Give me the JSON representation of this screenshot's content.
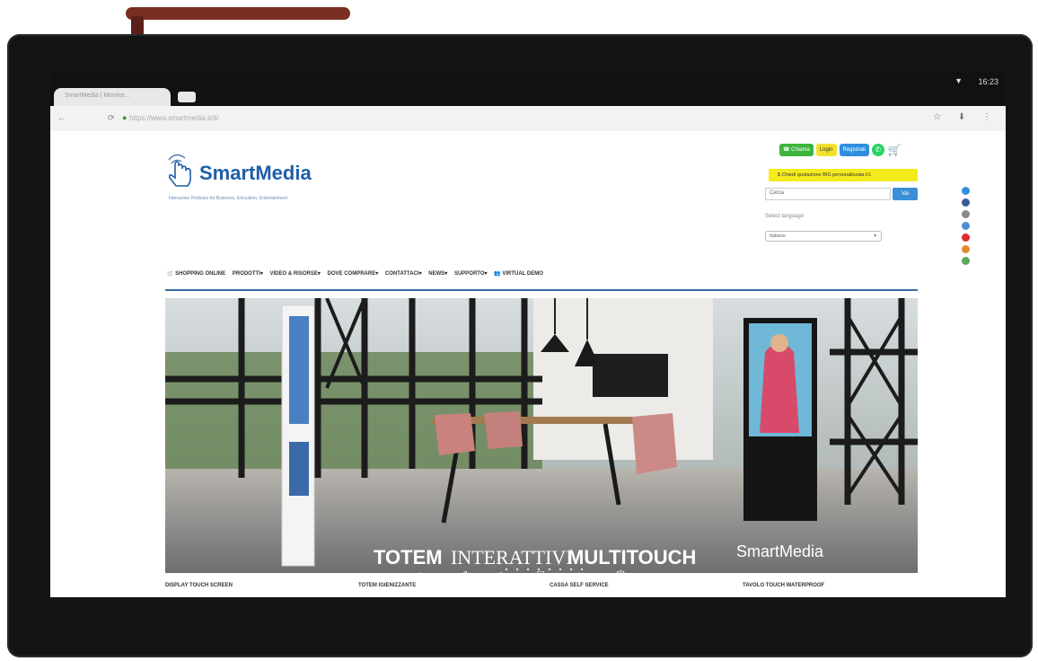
{
  "device": {
    "status_time": "16:23",
    "status_wifi_icon": "wifi-icon"
  },
  "browser": {
    "tab_title": "SmartMedia | Monitor...",
    "url": "https://www.smartmedia.it/it/",
    "url_icons": "☆ ⬇ ⋮"
  },
  "header": {
    "logo_text": "SmartMedia",
    "tagline": "Interactive Products for Business, Education, Entertainment",
    "actions": {
      "chiama": "☎ Chiama",
      "login": "Login",
      "registrati": "Registrati"
    },
    "quote_label": "$ Chiedi quotazione BIG personalizzata h1",
    "search_placeholder": "Cerca",
    "search_button": "Vai",
    "language_label": "Select language",
    "language_value": "Italiano"
  },
  "social_colors": [
    "#2f8fde",
    "#3b5998",
    "#888888",
    "#4a90d9",
    "#dd2c2c",
    "#e68a2e",
    "#5aa85a"
  ],
  "menu": [
    "🛒 SHOPPING ONLINE",
    "PRODOTTI▾",
    "VIDEO & RISORSE▾",
    "DOVE COMPRARE▾",
    "CONTATTACI▾",
    "NEWS▾",
    "SUPPORTO▾",
    "👥 VIRTUAL DEMO"
  ],
  "banner": {
    "headline_a": "TOTEM",
    "headline_b": "INTERATTIVI",
    "headline_c": "MULTITOUCH",
    "brand": "SmartMedia"
  },
  "categories": [
    "DISPLAY TOUCH SCREEN",
    "TOTEM IGIENIZZANTE",
    "CASSA SELF SERVICE",
    "TAVOLO TOUCH WATERPROOF"
  ]
}
